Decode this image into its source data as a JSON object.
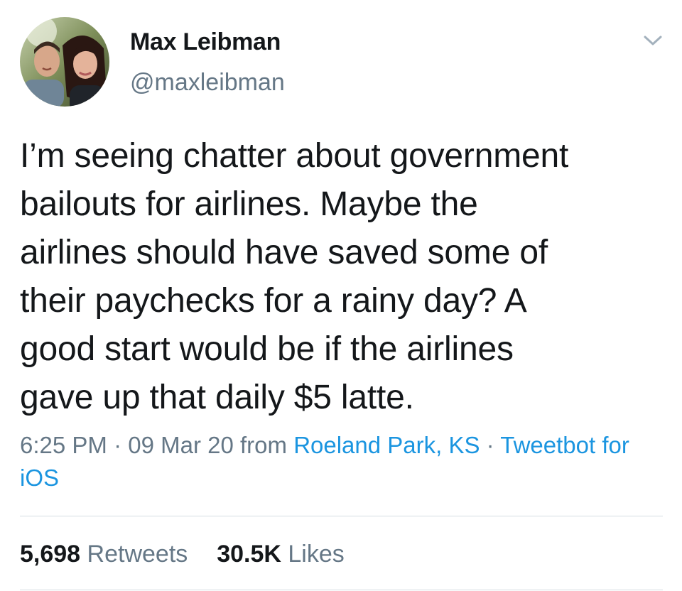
{
  "user": {
    "display_name": "Max Leibman",
    "handle": "@maxleibman"
  },
  "tweet": {
    "text": "I’m seeing chatter about government\nbailouts for airlines. Maybe the\nairlines should have saved some of\ntheir paychecks for a rainy day? A\ngood start would be if the airlines\ngave up that daily $5 latte."
  },
  "meta": {
    "time": "6:25 PM",
    "separator": "·",
    "date": "09 Mar 20",
    "from_label": "from",
    "location": "Roeland Park, KS",
    "client": "Tweetbot for iOS"
  },
  "stats": {
    "retweets_count": "5,698",
    "retweets_label": "Retweets",
    "likes_count": "30.5K",
    "likes_label": "Likes"
  },
  "icons": {
    "menu": "chevron-down-icon",
    "avatar": "profile-photo"
  },
  "colors": {
    "text": "#14171a",
    "secondary": "#657786",
    "link": "#1b95e0",
    "divider": "#d6dde3"
  }
}
